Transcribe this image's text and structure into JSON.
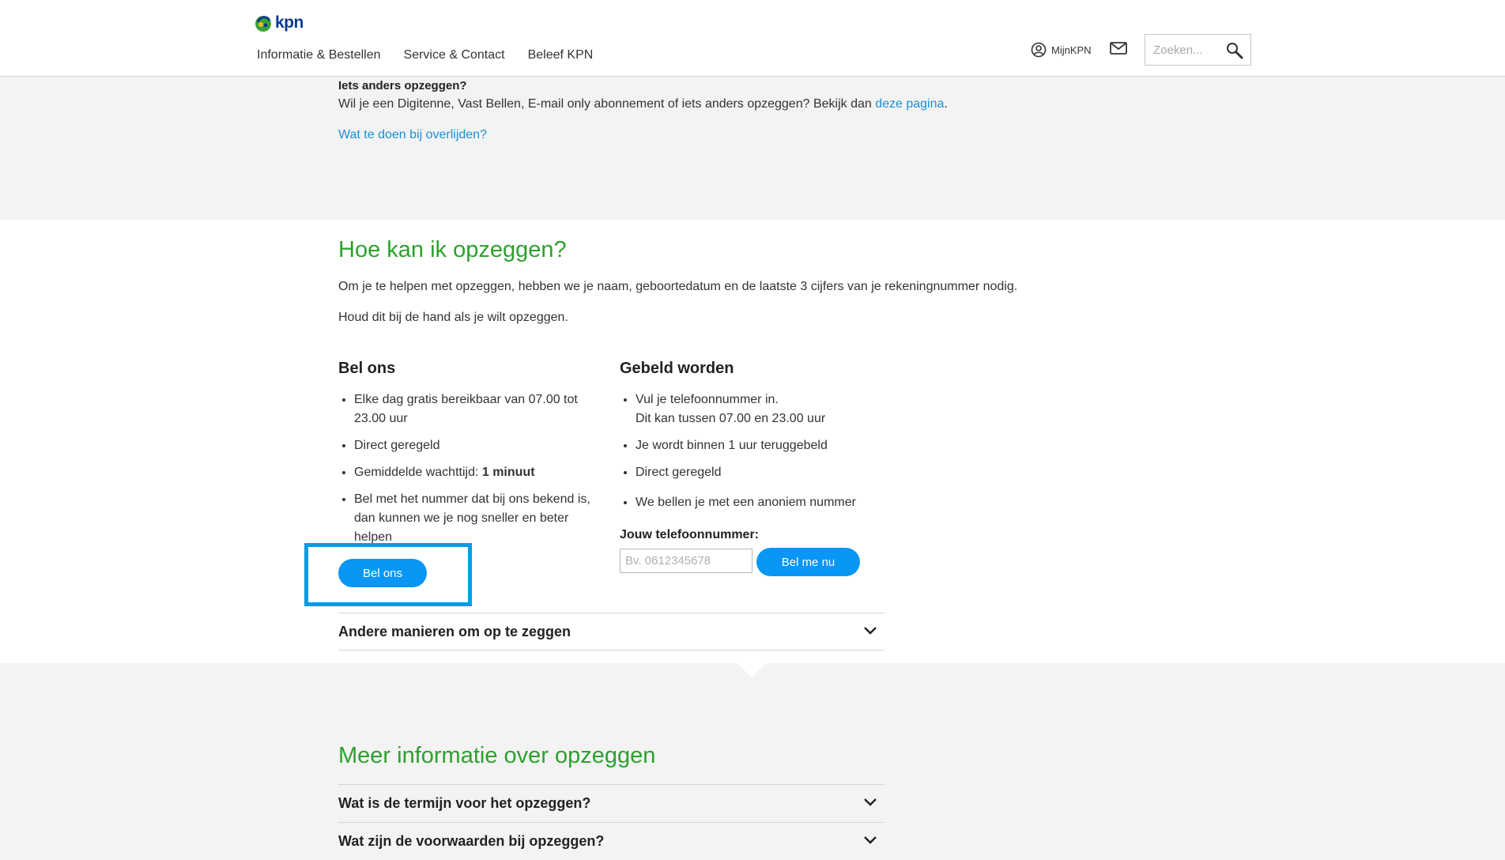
{
  "header": {
    "logo_text": "kpn",
    "nav": [
      "Informatie & Bestellen",
      "Service & Contact",
      "Beleef KPN"
    ],
    "mykpn_label": "MijnKPN",
    "search_placeholder": "Zoeken..."
  },
  "top": {
    "heading": "Iets anders opzeggen?",
    "text_before_link": "Wil je een Digitenne, Vast Bellen, E-mail only abonnement of iets anders opzeggen? Bekijk dan ",
    "link_text": "deze pagina",
    "text_after_link": ".",
    "overlijden_link": "Wat te doen bij overlijden?"
  },
  "how": {
    "title": "Hoe kan ik opzeggen?",
    "intro": "Om je te helpen met opzeggen, hebben we je naam, geboortedatum en de laatste 3 cijfers van je rekeningnummer nodig.",
    "note": "Houd dit bij de hand als je wilt opzeggen."
  },
  "bel_ons": {
    "title": "Bel ons",
    "bullet1_line1": "Elke dag gratis bereikbaar van 07.00 tot",
    "bullet1_line2": "23.00 uur",
    "bullet2": "Direct geregeld",
    "bullet3_prefix": "Gemiddelde wachttijd: ",
    "bullet3_bold": "1 minuut",
    "bullet4_line1": "Bel met het nummer dat bij ons bekend is,",
    "bullet4_line2": "dan kunnen we je nog sneller en beter",
    "bullet4_line3": "helpen",
    "button": "Bel ons"
  },
  "gebeld": {
    "title": "Gebeld worden",
    "bullet1_line1": "Vul je telefoonnummer in.",
    "bullet1_line2": "Dit kan tussen 07.00 en 23.00 uur",
    "bullet2": "Je wordt binnen 1 uur teruggebeld",
    "bullet3": "Direct geregeld",
    "bullet4": "We bellen je met een anoniem nummer",
    "phone_label": "Jouw telefoonnummer:",
    "phone_placeholder": "Bv. 0612345678",
    "button": "Bel me nu"
  },
  "accordion_other": "Andere manieren om op te zeggen",
  "more": {
    "title": "Meer informatie over opzeggen",
    "items": [
      "Wat is de termijn voor het opzeggen?",
      "Wat zijn de voorwaarden bij opzeggen?"
    ]
  },
  "colors": {
    "green": "#2ea02e",
    "blue": "#0996f5",
    "link": "#1b8fd8",
    "highlight": "#089be6"
  }
}
